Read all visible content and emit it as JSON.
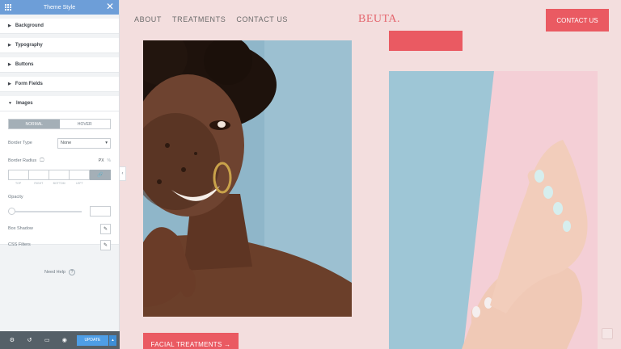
{
  "panel": {
    "title": "Theme Style",
    "sections": [
      "Background",
      "Typography",
      "Buttons",
      "Form Fields",
      "Images"
    ],
    "images": {
      "tabs": [
        "NORMAL",
        "HOVER"
      ],
      "border_type_label": "Border Type",
      "border_type_value": "None",
      "border_radius_label": "Border Radius",
      "border_radius_unit": "PX",
      "border_radius_unit_alt": "%",
      "quad_labels": [
        "TOP",
        "RIGHT",
        "BOTTOM",
        "LEFT"
      ],
      "opacity_label": "Opacity",
      "opacity_value": 0,
      "box_shadow_label": "Box Shadow",
      "css_filters_label": "CSS Filters"
    },
    "need_help": "Need Help",
    "footer": {
      "update_label": "UPDATE"
    }
  },
  "site": {
    "nav_links": [
      "ABOUT",
      "TREATMENTS",
      "CONTACT US"
    ],
    "logo": "BEUTA.",
    "contact_button": "CONTACT US",
    "facial_button": "FACIAL TREATMENTS →"
  },
  "colors": {
    "accent": "#ea5a62",
    "panel_header": "#6d9ed8",
    "page_bg": "#f3dede",
    "update": "#4e9ee6"
  }
}
